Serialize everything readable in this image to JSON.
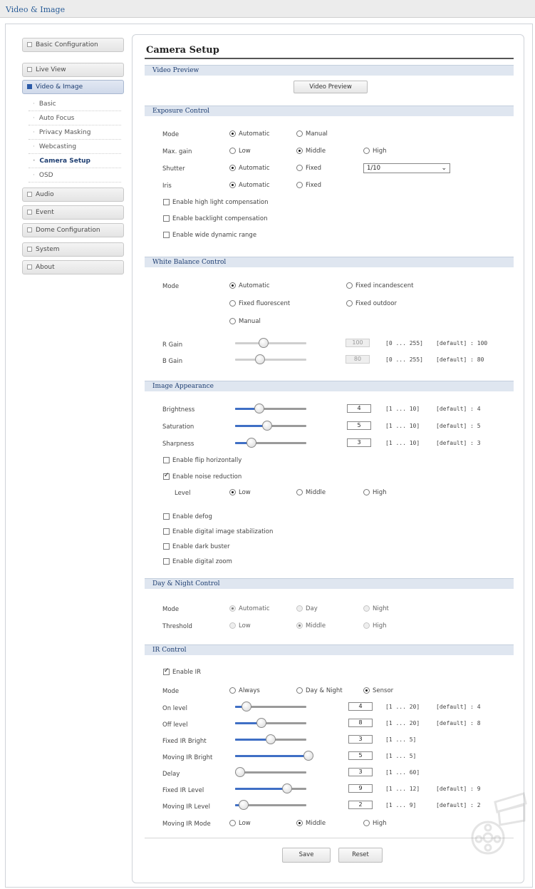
{
  "app": {
    "title": "Video & Image"
  },
  "sidebar": {
    "groups": [
      {
        "label": "Basic Configuration"
      },
      {
        "label": "Live View"
      },
      {
        "label": "Video & Image"
      },
      {
        "label": "Audio"
      },
      {
        "label": "Event"
      },
      {
        "label": "Dome Configuration"
      },
      {
        "label": "System"
      },
      {
        "label": "About"
      }
    ],
    "subitems": [
      {
        "label": "Basic"
      },
      {
        "label": "Auto Focus"
      },
      {
        "label": "Privacy Masking"
      },
      {
        "label": "Webcasting"
      },
      {
        "label": "Camera Setup"
      },
      {
        "label": "OSD"
      }
    ]
  },
  "page": {
    "title": "Camera Setup"
  },
  "video_preview": {
    "section": "Video Preview",
    "button": "Video Preview"
  },
  "exposure": {
    "section": "Exposure Control",
    "mode": {
      "label": "Mode",
      "options": [
        "Automatic",
        "Manual"
      ],
      "selected": "Automatic"
    },
    "max_gain": {
      "label": "Max. gain",
      "options": [
        "Low",
        "Middle",
        "High"
      ],
      "selected": "Middle"
    },
    "shutter": {
      "label": "Shutter",
      "options": [
        "Automatic",
        "Fixed"
      ],
      "selected": "Automatic",
      "value": "1/10"
    },
    "iris": {
      "label": "Iris",
      "options": [
        "Automatic",
        "Fixed"
      ],
      "selected": "Automatic"
    },
    "checks": [
      {
        "label": "Enable high light compensation",
        "checked": false
      },
      {
        "label": "Enable backlight compensation",
        "checked": false
      },
      {
        "label": "Enable wide dynamic range",
        "checked": false
      }
    ]
  },
  "white_balance": {
    "section": "White Balance Control",
    "mode_label": "Mode",
    "options": [
      "Automatic",
      "Fixed incandescent",
      "Fixed fluorescent",
      "Fixed outdoor",
      "Manual"
    ],
    "selected": "Automatic",
    "r_gain": {
      "label": "R Gain",
      "value": "100",
      "range": "[0 ... 255]",
      "default": "[default] : 100"
    },
    "b_gain": {
      "label": "B Gain",
      "value": "80",
      "range": "[0 ... 255]",
      "default": "[default] : 80"
    }
  },
  "image": {
    "section": "Image Appearance",
    "brightness": {
      "label": "Brightness",
      "value": "4",
      "range": "[1 ... 10]",
      "default": "[default] : 4"
    },
    "saturation": {
      "label": "Saturation",
      "value": "5",
      "range": "[1 ... 10]",
      "default": "[default] : 5"
    },
    "sharpness": {
      "label": "Sharpness",
      "value": "3",
      "range": "[1 ... 10]",
      "default": "[default] : 3"
    },
    "flip": {
      "label": "Enable flip horizontally",
      "checked": false
    },
    "noise": {
      "label": "Enable noise reduction",
      "checked": true
    },
    "level": {
      "label": "Level",
      "options": [
        "Low",
        "Middle",
        "High"
      ],
      "selected": "Low"
    },
    "checks": [
      {
        "label": "Enable defog",
        "checked": false
      },
      {
        "label": "Enable digital image stabilization",
        "checked": false
      },
      {
        "label": "Enable dark buster",
        "checked": false
      },
      {
        "label": "Enable digital zoom",
        "checked": false
      }
    ]
  },
  "day_night": {
    "section": "Day & Night Control",
    "mode": {
      "label": "Mode",
      "options": [
        "Automatic",
        "Day",
        "Night"
      ],
      "selected": "Automatic"
    },
    "threshold": {
      "label": "Threshold",
      "options": [
        "Low",
        "Middle",
        "High"
      ],
      "selected": "Middle"
    }
  },
  "ir": {
    "section": "IR Control",
    "enable": {
      "label": "Enable IR",
      "checked": true
    },
    "mode": {
      "label": "Mode",
      "options": [
        "Always",
        "Day & Night",
        "Sensor"
      ],
      "selected": "Sensor"
    },
    "on_level": {
      "label": "On level",
      "value": "4",
      "range": "[1 ... 20]",
      "default": "[default] : 4"
    },
    "off_level": {
      "label": "Off level",
      "value": "8",
      "range": "[1 ... 20]",
      "default": "[default] : 8"
    },
    "fixed_bright": {
      "label": "Fixed IR Bright",
      "value": "3",
      "range": "[1 ... 5]"
    },
    "moving_bright": {
      "label": "Moving IR Bright",
      "value": "5",
      "range": "[1 ... 5]"
    },
    "delay": {
      "label": "Delay",
      "value": "3",
      "range": "[1 ... 60]"
    },
    "fixed_level": {
      "label": "Fixed IR Level",
      "value": "9",
      "range": "[1 ... 12]",
      "default": "[default] : 9"
    },
    "moving_level": {
      "label": "Moving IR Level",
      "value": "2",
      "range": "[1 ... 9]",
      "default": "[default] : 2"
    },
    "moving_mode": {
      "label": "Moving IR Mode",
      "options": [
        "Low",
        "Middle",
        "High"
      ],
      "selected": "Middle"
    }
  },
  "buttons": {
    "save": "Save",
    "reset": "Reset"
  }
}
